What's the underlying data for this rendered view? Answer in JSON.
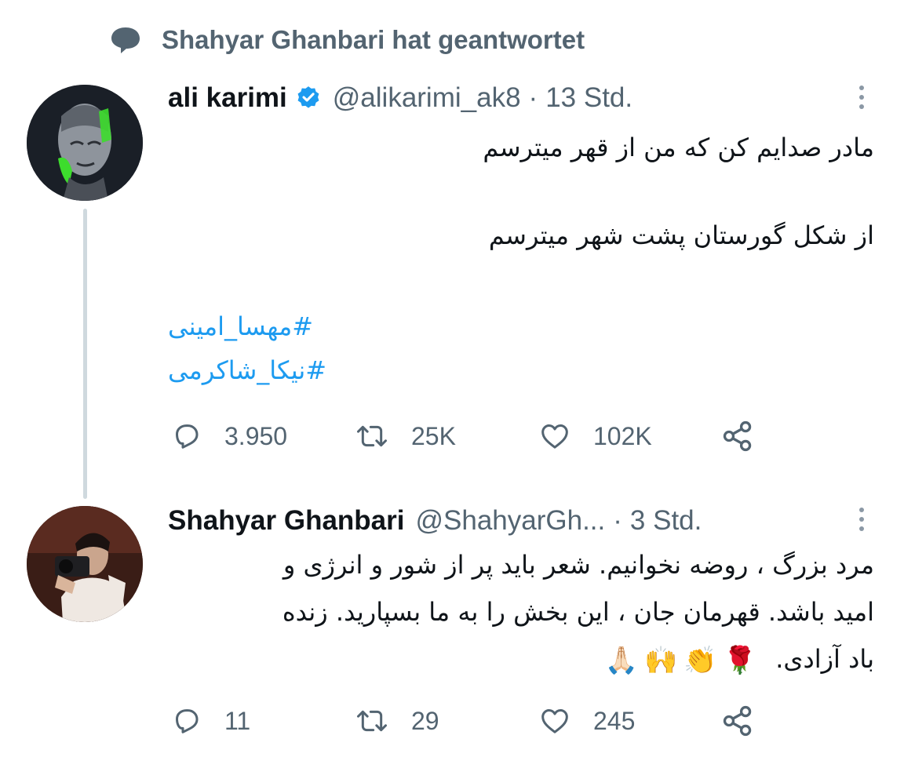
{
  "reply_context": {
    "icon": "speech-bubble-icon",
    "text": "Shahyar Ghanbari hat geantwortet"
  },
  "tweets": [
    {
      "author": "ali karimi",
      "verified": true,
      "handle": "@alikarimi_ak8",
      "separator": "·",
      "time": "13 Std.",
      "lines": [
        "مادر صدایم کن که من از قهر میترسم",
        "از شکل گورستان پشت شهر میترسم"
      ],
      "hashtags": [
        "#مهسا_امینی",
        "#نیکا_شاکرمی"
      ],
      "stats": {
        "replies": "3.950",
        "retweets": "25K",
        "likes": "102K"
      }
    },
    {
      "author": "Shahyar Ghanbari",
      "verified": false,
      "handle": "@ShahyarGh...",
      "separator": "·",
      "time": "3 Std.",
      "lines": [
        "مرد بزرگ ، روضه نخوانیم. شعر باید پر از شور و انرژی و",
        "امید باشد. قهرمان جان ، این بخش را به ما بسپارید. زنده",
        "باد آزادی."
      ],
      "emojis": [
        "🙏🏻",
        "🙌",
        "👏",
        "🌹"
      ],
      "stats": {
        "replies": "11",
        "retweets": "29",
        "likes": "245"
      }
    }
  ],
  "colors": {
    "secondary_text": "#536471",
    "link": "#1d9bf0",
    "thread_line": "#cfd9de",
    "verified_badge": "#1d9bf0"
  }
}
